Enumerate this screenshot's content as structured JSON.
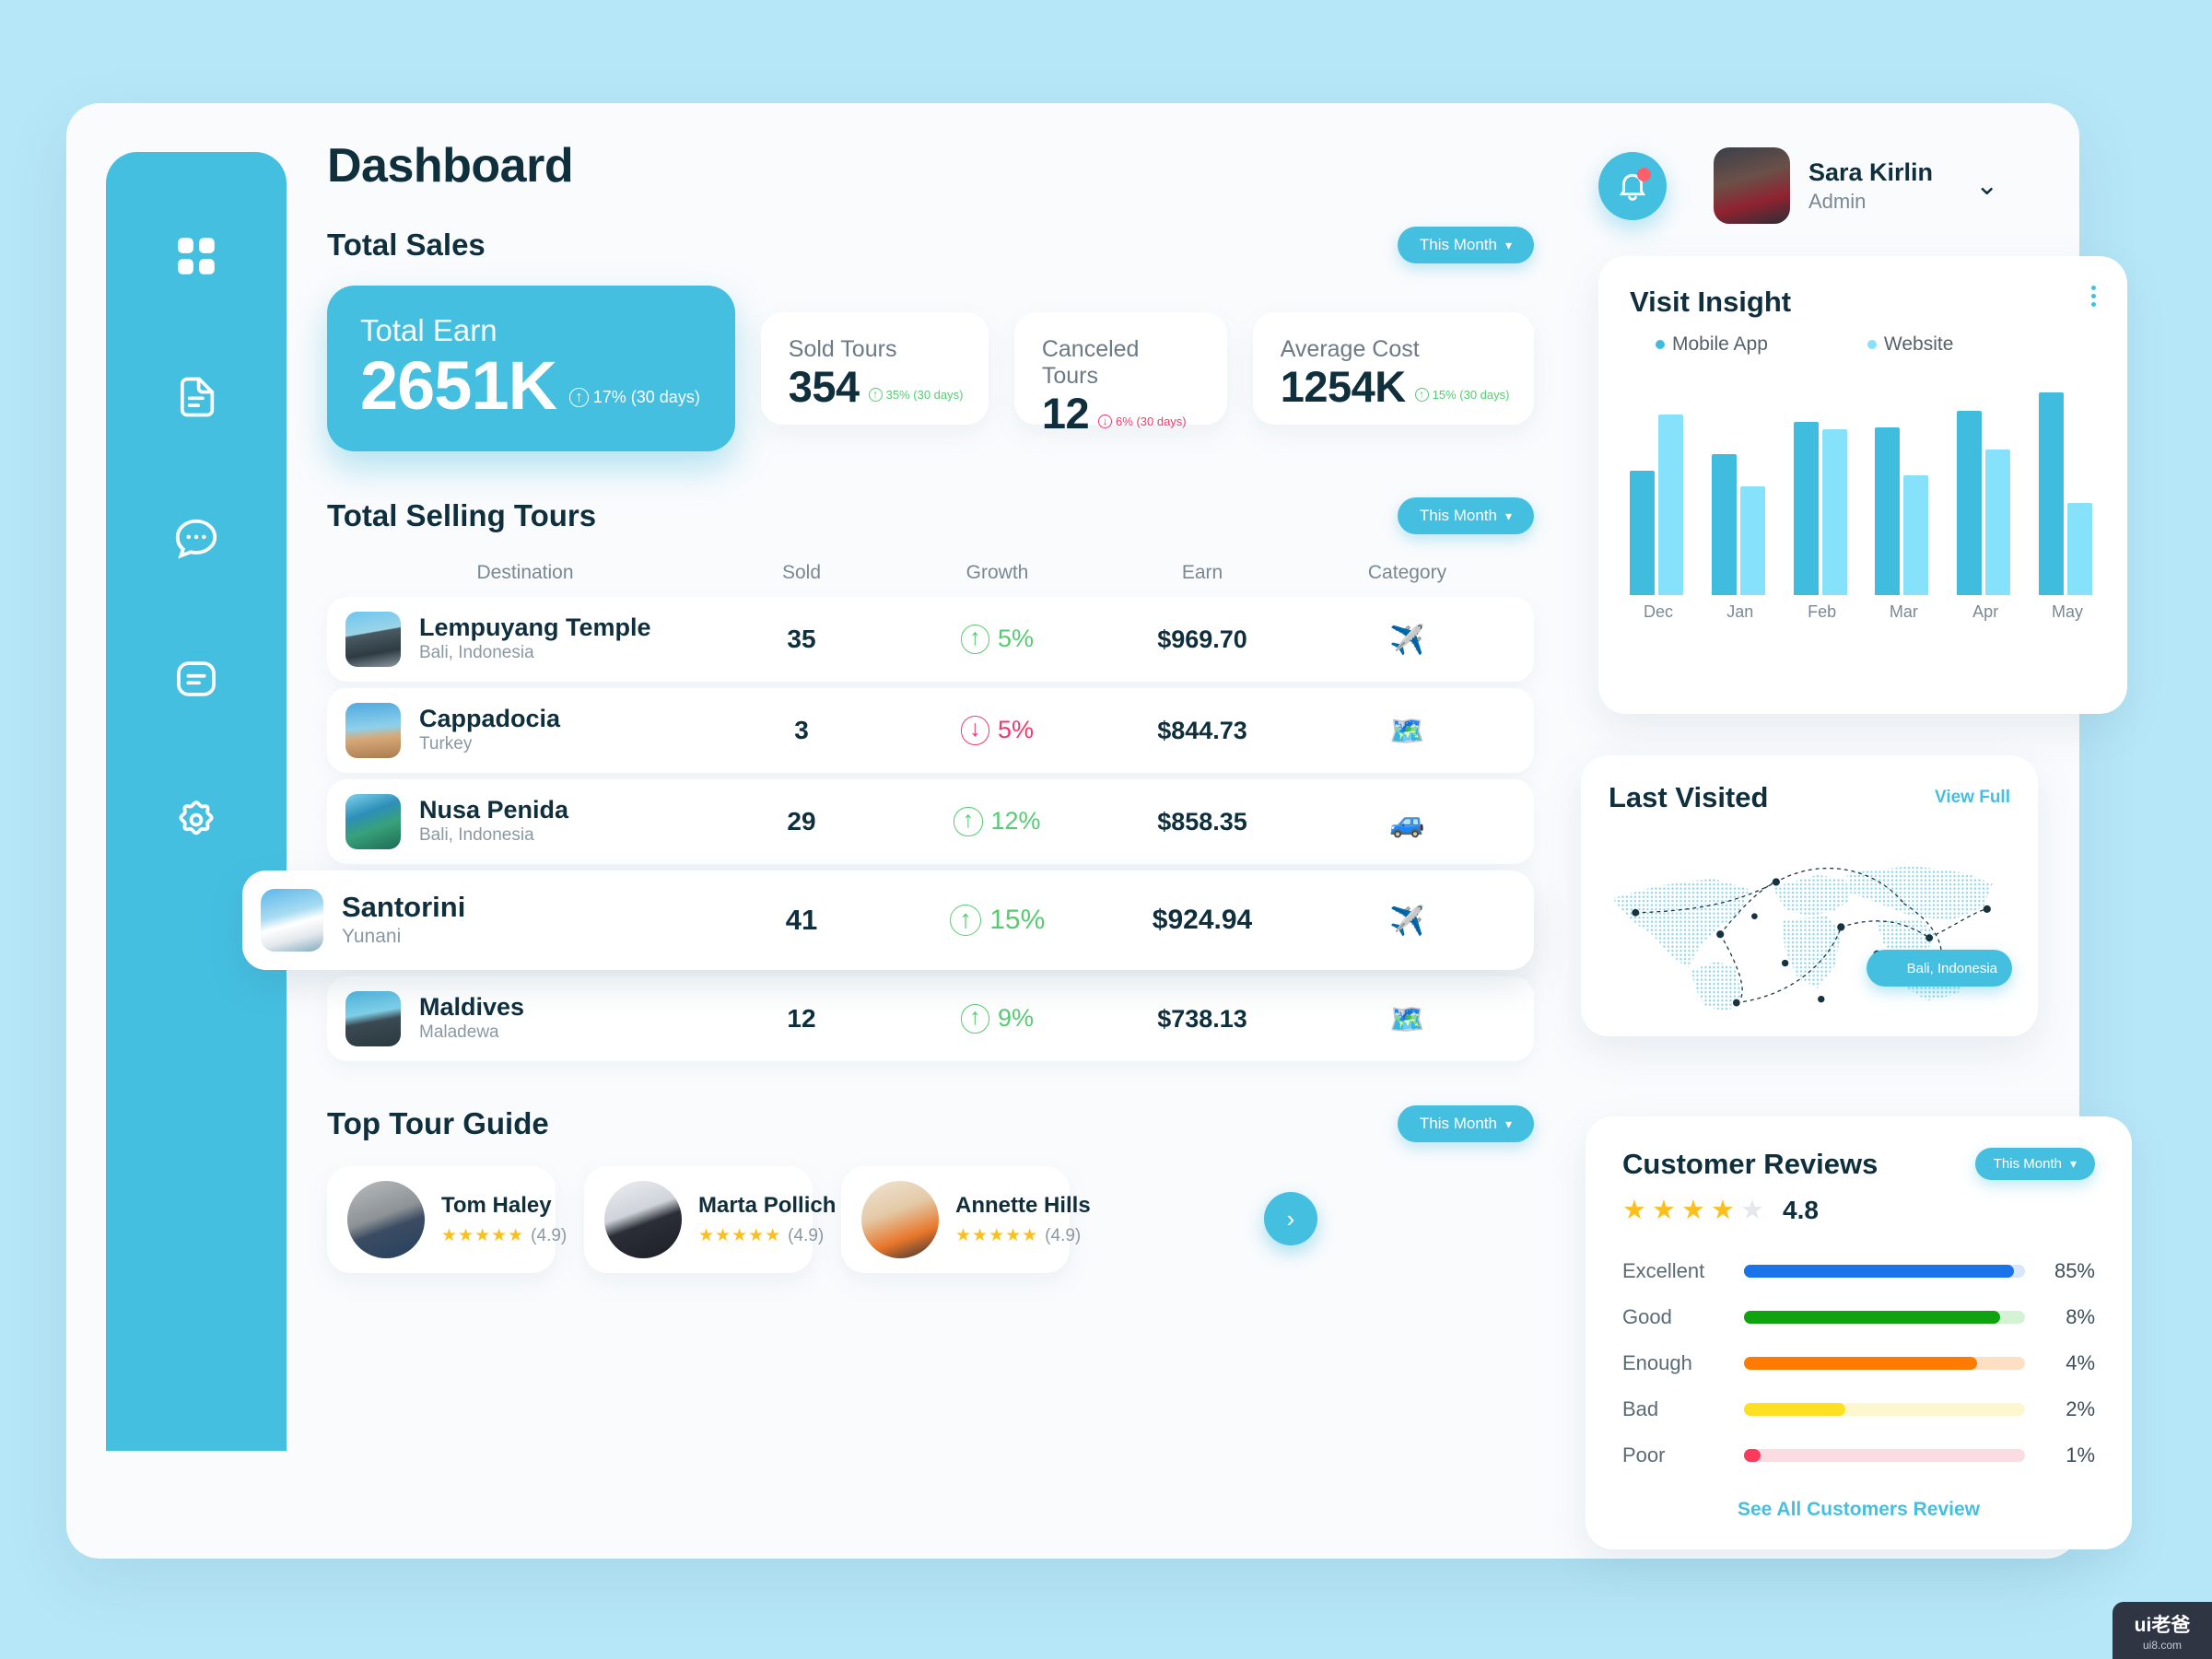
{
  "header": {
    "title": "Dashboard",
    "user_name": "Sara Kirlin",
    "user_role": "Admin",
    "chevron": "⌄"
  },
  "brand": {
    "accent": "#45bfe0",
    "up": "#55cc72",
    "down": "#f3386b"
  },
  "sidebar": {
    "items": [
      {
        "name": "grid-icon",
        "label": "Dashboard",
        "active": true
      },
      {
        "name": "document-icon",
        "label": "Documents"
      },
      {
        "name": "chat-icon",
        "label": "Messages"
      },
      {
        "name": "list-icon",
        "label": "Reports"
      },
      {
        "name": "gear-icon",
        "label": "Settings"
      }
    ]
  },
  "total_sales": {
    "title": "Total Sales",
    "filter_label": "This Month",
    "earn_card": {
      "label": "Total Earn",
      "value": "2651K",
      "delta": "17% (30 days)",
      "direction": "up"
    },
    "stats": [
      {
        "label": "Sold Tours",
        "value": "354",
        "delta": "35% (30 days)",
        "direction": "up"
      },
      {
        "label": "Canceled Tours",
        "value": "12",
        "delta": "6% (30 days)",
        "direction": "down"
      },
      {
        "label": "Average Cost",
        "value": "1254K",
        "delta": "15% (30 days)",
        "direction": "up"
      }
    ]
  },
  "selling_tours": {
    "title": "Total Selling Tours",
    "filter_label": "This Month",
    "columns": [
      "Destination",
      "Sold",
      "Growth",
      "Earn",
      "Category"
    ],
    "rows": [
      {
        "name": "Lempuyang Temple",
        "location": "Bali, Indonesia",
        "sold": "35",
        "growth": "5%",
        "direction": "up",
        "earn": "$969.70",
        "category_icon": "✈️",
        "category": "flight",
        "photo": "ph1",
        "active": false
      },
      {
        "name": "Cappadocia",
        "location": "Turkey",
        "sold": "3",
        "growth": "5%",
        "direction": "down",
        "earn": "$844.73",
        "category_icon": "🗺️",
        "category": "map",
        "photo": "ph2",
        "active": false
      },
      {
        "name": "Nusa Penida",
        "location": "Bali, Indonesia",
        "sold": "29",
        "growth": "12%",
        "direction": "up",
        "earn": "$858.35",
        "category_icon": "🚙",
        "category": "car",
        "photo": "ph3",
        "active": false
      },
      {
        "name": "Santorini",
        "location": "Yunani",
        "sold": "41",
        "growth": "15%",
        "direction": "up",
        "earn": "$924.94",
        "category_icon": "✈️",
        "category": "flight",
        "photo": "ph4",
        "active": true
      },
      {
        "name": "Maldives",
        "location": "Maladewa",
        "sold": "12",
        "growth": "9%",
        "direction": "up",
        "earn": "$738.13",
        "category_icon": "🗺️",
        "category": "map",
        "photo": "ph5",
        "active": false
      }
    ]
  },
  "tour_guide": {
    "title": "Top Tour Guide",
    "filter_label": "This Month",
    "next_icon": "›",
    "guides": [
      {
        "name": "Tom Haley",
        "stars": "★★★★★",
        "score": "(4.9)",
        "photo": "pha"
      },
      {
        "name": "Marta Pollich",
        "stars": "★★★★★",
        "score": "(4.9)",
        "photo": "phb"
      },
      {
        "name": "Annette Hills",
        "stars": "★★★★★",
        "score": "(4.9)",
        "photo": "phc"
      }
    ]
  },
  "visit_insight": {
    "title": "Visit Insight",
    "menu_icon": "kebab-menu"
  },
  "chart_data": {
    "type": "bar",
    "title": "Visit Insight",
    "categories": [
      "Dec",
      "Jan",
      "Feb",
      "Mar",
      "Apr",
      "May"
    ],
    "series": [
      {
        "name": "Mobile App",
        "color": "#3fbcde",
        "values": [
          135,
          153,
          188,
          182,
          200,
          220
        ]
      },
      {
        "name": "Website",
        "color": "#86e2fb",
        "values": [
          196,
          118,
          180,
          130,
          158,
          100
        ]
      }
    ],
    "ylim": [
      0,
      232
    ],
    "grid": false,
    "legend_position": "top",
    "xlabel": "",
    "ylabel": ""
  },
  "last_visited": {
    "title": "Last Visited",
    "view_full": "View Full",
    "pin_label": "Bali, Indonesia"
  },
  "reviews": {
    "title": "Customer Reviews",
    "filter_label": "This Month",
    "score": "4.8",
    "stars_filled": 4,
    "stars_total": 5,
    "see_all": "See All Customers Review",
    "rows": [
      {
        "label": "Excellent",
        "pct": "85%",
        "fill": 96,
        "color": "#1a73e8",
        "track": "#d6e6fb"
      },
      {
        "label": "Good",
        "pct": "8%",
        "fill": 91,
        "color": "#10a310",
        "track": "#d4f3d4"
      },
      {
        "label": "Enough",
        "pct": "4%",
        "fill": 83,
        "color": "#ff7a00",
        "track": "#fde0c4"
      },
      {
        "label": "Bad",
        "pct": "2%",
        "fill": 36,
        "color": "#fde021",
        "track": "#fcf7cf"
      },
      {
        "label": "Poor",
        "pct": "1%",
        "fill": 6,
        "color": "#fb3a5d",
        "track": "#fcdce3"
      }
    ]
  },
  "watermark": {
    "top": "ui老爸",
    "bottom": "ui8.com"
  }
}
